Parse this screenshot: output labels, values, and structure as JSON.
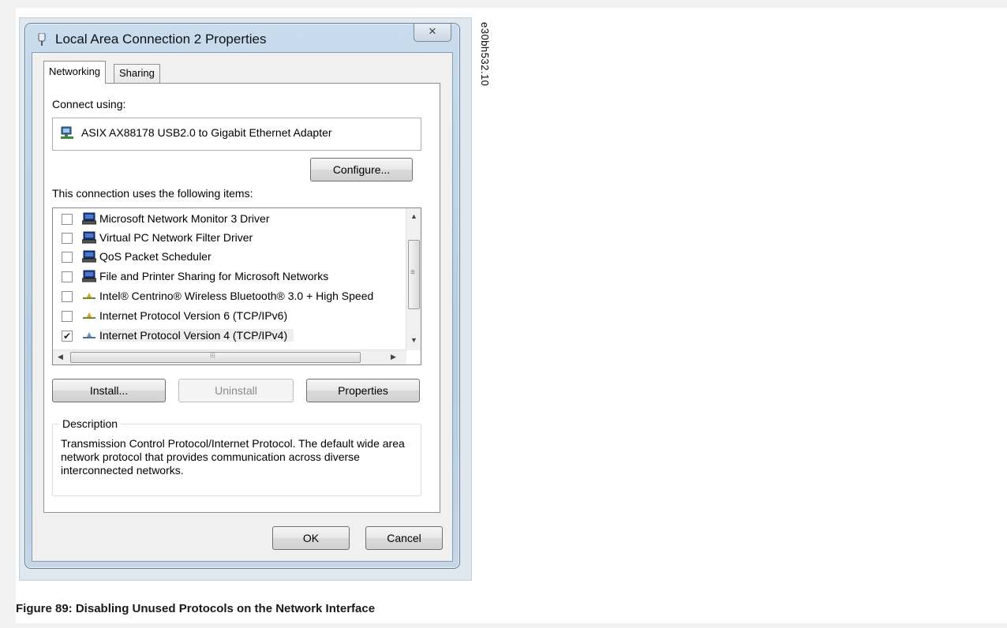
{
  "window": {
    "title": "Local Area Connection 2 Properties",
    "close_glyph": "✕"
  },
  "tabs": [
    {
      "label": "Networking",
      "active": true
    },
    {
      "label": "Sharing",
      "active": false
    }
  ],
  "connect_using": {
    "label": "Connect using:",
    "adapter": "ASIX AX88178 USB2.0 to Gigabit Ethernet Adapter",
    "adapter_icon": "network-adapter-icon"
  },
  "buttons": {
    "configure": "Configure...",
    "install": "Install...",
    "uninstall": "Uninstall",
    "properties": "Properties",
    "ok": "OK",
    "cancel": "Cancel"
  },
  "items_label": "This connection uses the following items:",
  "items": [
    {
      "label": "Microsoft Network Monitor 3 Driver",
      "checked": false,
      "icon": "client-icon"
    },
    {
      "label": "Virtual PC Network Filter Driver",
      "checked": false,
      "icon": "client-icon"
    },
    {
      "label": "QoS Packet Scheduler",
      "checked": false,
      "icon": "client-icon"
    },
    {
      "label": "File and Printer Sharing for Microsoft Networks",
      "checked": false,
      "icon": "client-icon"
    },
    {
      "label": "Intel® Centrino® Wireless Bluetooth® 3.0 + High Speed",
      "checked": false,
      "icon": "protocol-icon"
    },
    {
      "label": "Internet Protocol Version 6 (TCP/IPv6)",
      "checked": false,
      "icon": "protocol-icon"
    },
    {
      "label": "Internet Protocol Version 4 (TCP/IPv4)",
      "checked": true,
      "icon": "protocol-icon",
      "selected": true
    }
  ],
  "description": {
    "legend": "Description",
    "text": "Transmission Control Protocol/Internet Protocol. The default wide area network protocol that provides communication across diverse interconnected networks."
  },
  "side_code": "e30bh532.10",
  "caption": "Figure 89: Disabling Unused Protocols on the Network Interface",
  "colors": {
    "frame": "#b7cde3",
    "dialog_bg": "#f0f0f0",
    "selection": "#eeeeee"
  }
}
